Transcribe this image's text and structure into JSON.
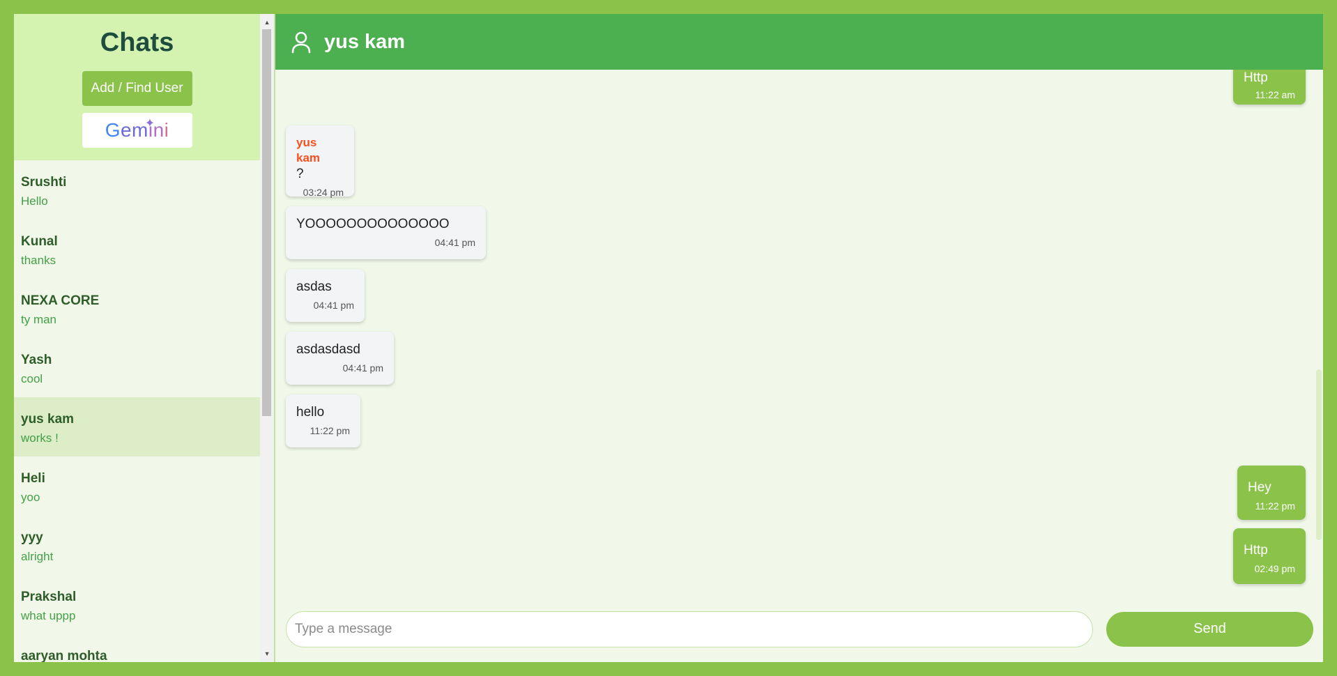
{
  "sidebar": {
    "title": "Chats",
    "add_button": "Add / Find User",
    "gemini_label": "Gemini",
    "chats": [
      {
        "name": "Srushti",
        "last": "Hello"
      },
      {
        "name": "Kunal",
        "last": "thanks"
      },
      {
        "name": "NEXA CORE",
        "last": "ty man"
      },
      {
        "name": "Yash",
        "last": "cool"
      },
      {
        "name": "yus kam",
        "last": "works !"
      },
      {
        "name": "Heli",
        "last": "yoo"
      },
      {
        "name": "yyy",
        "last": "alright"
      },
      {
        "name": "Prakshal",
        "last": "what uppp"
      },
      {
        "name": "aaryan mohta",
        "last": ""
      }
    ]
  },
  "header": {
    "name": "yus kam",
    "icon": "user-icon"
  },
  "messages": [
    {
      "dir": "out",
      "text": "Http",
      "time": "11:22 am"
    },
    {
      "dir": "in",
      "sender": "yus kam",
      "text": "?",
      "time": "03:24 pm"
    },
    {
      "dir": "in",
      "text": "YOOOOOOOOOOOOOO",
      "time": "04:41 pm"
    },
    {
      "dir": "in",
      "text": "asdas",
      "time": "04:41 pm"
    },
    {
      "dir": "in",
      "text": "asdasdasd",
      "time": "04:41 pm"
    },
    {
      "dir": "in",
      "text": "hello",
      "time": "11:22 pm"
    },
    {
      "dir": "out",
      "text": "Hey",
      "time": "11:22 pm"
    },
    {
      "dir": "out",
      "text": "Http",
      "time": "02:49 pm"
    }
  ],
  "composer": {
    "placeholder": "Type a message",
    "send_label": "Send"
  },
  "colors": {
    "frame": "#8bc34a",
    "header": "#4caf50",
    "sidebar_head": "#d4f2b0",
    "active_chat": "#dcedc8",
    "sender_name": "#f4511e"
  }
}
